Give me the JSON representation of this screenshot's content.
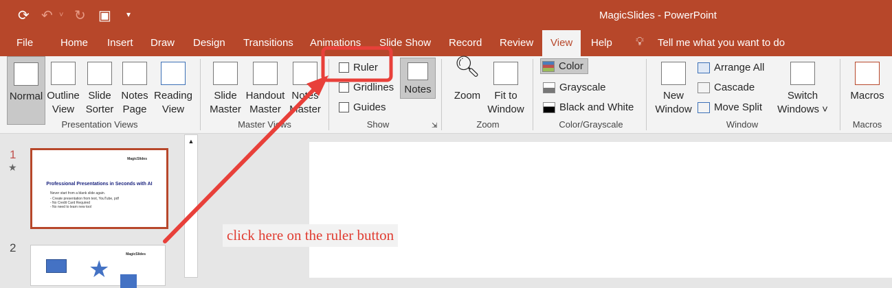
{
  "app": {
    "title": "MagicSlides  -  PowerPoint"
  },
  "qat": {
    "icons": [
      "autosave-icon",
      "undo-icon",
      "redo-icon",
      "present-icon",
      "customize-icon"
    ]
  },
  "tabs": [
    "File",
    "Home",
    "Insert",
    "Draw",
    "Design",
    "Transitions",
    "Animations",
    "Slide Show",
    "Record",
    "Review",
    "View",
    "Help"
  ],
  "active_tab": "View",
  "tell_me": "Tell me what you want to do",
  "ribbon": {
    "presentation_views": {
      "label": "Presentation Views",
      "buttons": [
        [
          "Normal",
          ""
        ],
        [
          "Outline",
          "View"
        ],
        [
          "Slide",
          "Sorter"
        ],
        [
          "Notes",
          "Page"
        ],
        [
          "Reading",
          "View"
        ]
      ]
    },
    "master_views": {
      "label": "Master Views",
      "buttons": [
        [
          "Slide",
          "Master"
        ],
        [
          "Handout",
          "Master"
        ],
        [
          "Notes",
          "Master"
        ]
      ]
    },
    "show": {
      "label": "Show",
      "ruler": "Ruler",
      "gridlines": "Gridlines",
      "guides": "Guides",
      "notes": "Notes"
    },
    "zoom": {
      "label": "Zoom",
      "zoom": "Zoom",
      "fit": [
        "Fit to",
        "Window"
      ]
    },
    "color": {
      "label": "Color/Grayscale",
      "color": "Color",
      "grayscale": "Grayscale",
      "bw": "Black and White"
    },
    "window": {
      "label": "Window",
      "new": [
        "New",
        "Window"
      ],
      "arrange": "Arrange All",
      "cascade": "Cascade",
      "move_split": "Move Split",
      "switch": [
        "Switch",
        "Windows ˅"
      ]
    },
    "macros": {
      "label": "Macros",
      "macros": "Macros"
    }
  },
  "slides": [
    {
      "number": "1",
      "logo": "MagicSlides",
      "title": "Professional Presentations in Seconds with AI",
      "body": [
        "Never start from a blank slide again.",
        "- Create presentation from text, YouTube, pdf",
        "- No Credit Card Required",
        "- No need to learn new tool"
      ]
    },
    {
      "number": "2",
      "logo": "MagicSlides"
    }
  ],
  "annotation": "click here on the ruler button",
  "colors": {
    "brand": "#b7472a",
    "annotation": "#e8403a"
  }
}
